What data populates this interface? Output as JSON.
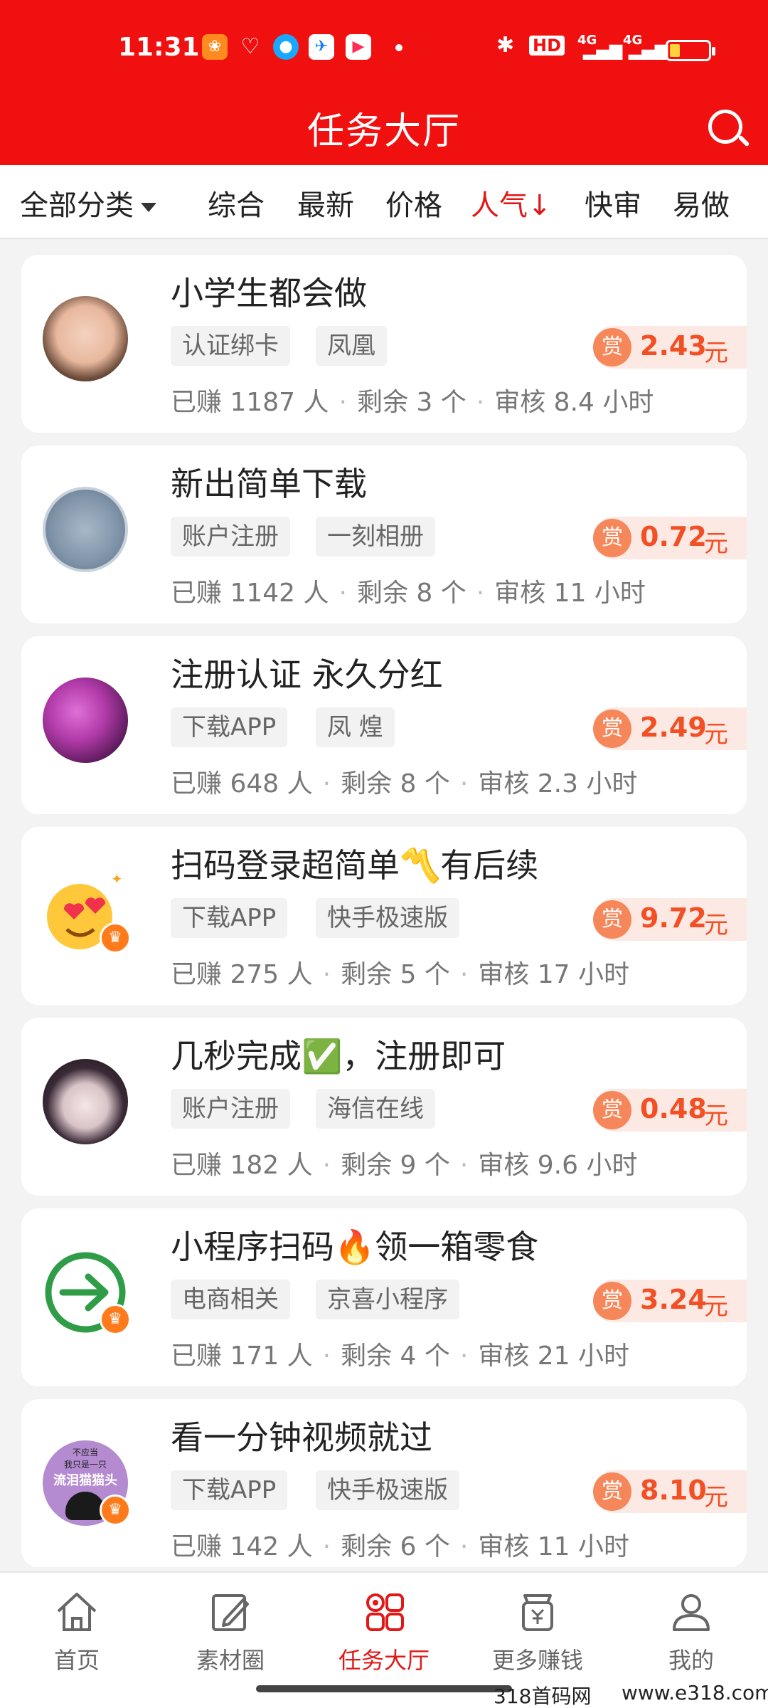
{
  "status_bar": {
    "time": "11:31",
    "right_indicators": [
      "HD",
      "4G",
      "4G"
    ]
  },
  "header": {
    "title": "任务大厅"
  },
  "filters": {
    "category": "全部分类",
    "items": [
      "综合",
      "最新",
      "价格",
      "人气↓",
      "快审",
      "易做"
    ],
    "active": "人气↓"
  },
  "tasks": [
    {
      "title": "小学生都会做",
      "tags": [
        "认证绑卡",
        "凤凰"
      ],
      "reward_label": "赏",
      "reward": "2.43",
      "unit": "元",
      "earned": "已赚 1187 人",
      "remaining": "剩余 3 个",
      "review": "审核 8.4 小时"
    },
    {
      "title": "新出简单下载",
      "tags": [
        "账户注册",
        "一刻相册"
      ],
      "reward_label": "赏",
      "reward": "0.72",
      "unit": "元",
      "earned": "已赚 1142 人",
      "remaining": "剩余 8 个",
      "review": "审核 11 小时"
    },
    {
      "title": "注册认证 永久分红",
      "tags": [
        "下载APP",
        "凤 煌"
      ],
      "reward_label": "赏",
      "reward": "2.49",
      "unit": "元",
      "earned": "已赚 648 人",
      "remaining": "剩余 8 个",
      "review": "审核 2.3 小时"
    },
    {
      "title": "扫码登录超简单〽️有后续",
      "tags": [
        "下载APP",
        "快手极速版"
      ],
      "reward_label": "赏",
      "reward": "9.72",
      "unit": "元",
      "earned": "已赚 275 人",
      "remaining": "剩余 5 个",
      "review": "审核 17 小时"
    },
    {
      "title": "几秒完成✅，注册即可",
      "tags": [
        "账户注册",
        "海信在线"
      ],
      "reward_label": "赏",
      "reward": "0.48",
      "unit": "元",
      "earned": "已赚 182 人",
      "remaining": "剩余 9 个",
      "review": "审核 9.6 小时"
    },
    {
      "title": "小程序扫码🔥领一箱零食",
      "tags": [
        "电商相关",
        "京喜小程序"
      ],
      "reward_label": "赏",
      "reward": "3.24",
      "unit": "元",
      "earned": "已赚 171 人",
      "remaining": "剩余 4 个",
      "review": "审核 21 小时"
    },
    {
      "title": "看一分钟视频就过",
      "tags": [
        "下载APP",
        "快手极速版"
      ],
      "reward_label": "赏",
      "reward": "8.10",
      "unit": "元",
      "earned": "已赚 142 人",
      "remaining": "剩余 6 个",
      "review": "审核 11 小时"
    }
  ],
  "avatar7_text": {
    "line1": "不应当",
    "line2": "我只是一只",
    "line3": "流泪猫猫头"
  },
  "tabbar": {
    "items": [
      {
        "label": "首页",
        "icon": "home-icon"
      },
      {
        "label": "素材圈",
        "icon": "edit-icon"
      },
      {
        "label": "任务大厅",
        "icon": "grid-icon"
      },
      {
        "label": "更多赚钱",
        "icon": "yen-bag-icon"
      },
      {
        "label": "我的",
        "icon": "person-icon"
      }
    ],
    "active": "任务大厅"
  },
  "watermark": {
    "left": "318首码网",
    "right": "www.e318.com"
  },
  "colors": {
    "brand_red": "#f01010",
    "reward_orange": "#f24f24",
    "reward_bg": "#fde9e4"
  }
}
